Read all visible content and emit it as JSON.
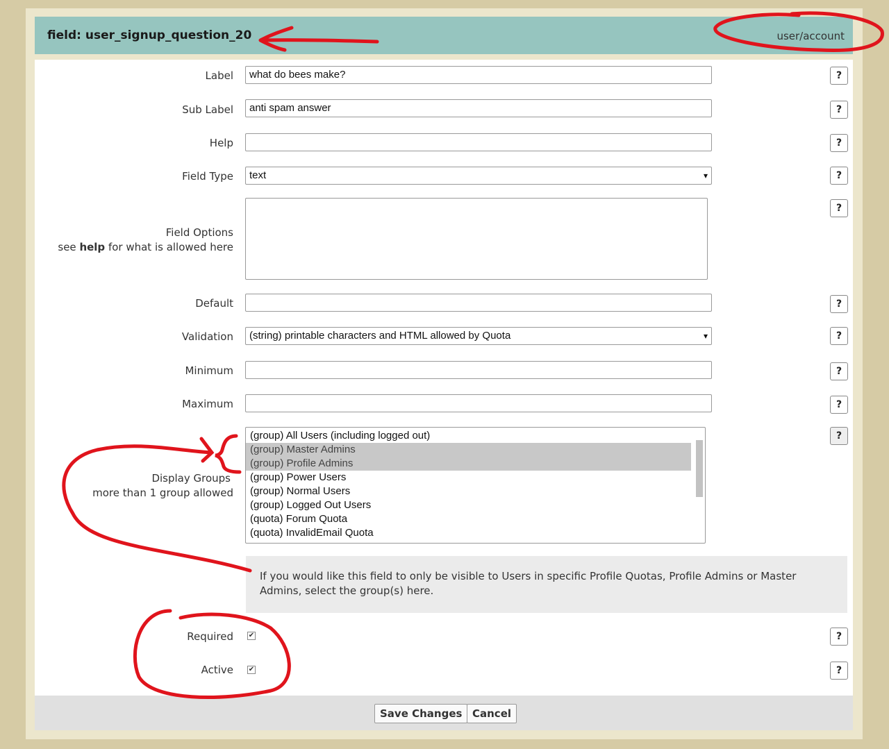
{
  "header": {
    "title": "field: user_signup_question_20",
    "breadcrumb": "user/account"
  },
  "fields": {
    "label": {
      "label": "Label",
      "value": "what do bees make?"
    },
    "sub_label": {
      "label": "Sub Label",
      "value": "anti spam answer"
    },
    "help": {
      "label": "Help",
      "value": ""
    },
    "field_type": {
      "label": "Field Type",
      "value": "text"
    },
    "field_options": {
      "label": "Field Options",
      "hint_pre": "see ",
      "hint_bold": "help",
      "hint_post": " for what is allowed here"
    },
    "default": {
      "label": "Default",
      "value": ""
    },
    "validation": {
      "label": "Validation",
      "value": "(string) printable characters and HTML allowed by Quota"
    },
    "minimum": {
      "label": "Minimum",
      "value": ""
    },
    "maximum": {
      "label": "Maximum",
      "value": ""
    },
    "display_groups": {
      "label": "Display Groups",
      "hint": "more than 1 group allowed",
      "options": [
        {
          "text": "(group) All Users (including logged out)",
          "selected": false
        },
        {
          "text": "(group) Master Admins",
          "selected": true
        },
        {
          "text": "(group) Profile Admins",
          "selected": true
        },
        {
          "text": "(group) Power Users",
          "selected": false
        },
        {
          "text": "(group) Normal Users",
          "selected": false
        },
        {
          "text": "(group) Logged Out Users",
          "selected": false
        },
        {
          "text": "(quota) Forum Quota",
          "selected": false
        },
        {
          "text": "(quota) InvalidEmail Quota",
          "selected": false
        }
      ],
      "info": "If you would like this field to only be visible to Users in specific Profile Quotas, Profile Admins or Master Admins, select the group(s) here."
    },
    "required": {
      "label": "Required",
      "checked": true
    },
    "active": {
      "label": "Active",
      "checked": true
    }
  },
  "help_button": "?",
  "footer": {
    "save": "Save Changes",
    "cancel": "Cancel"
  }
}
